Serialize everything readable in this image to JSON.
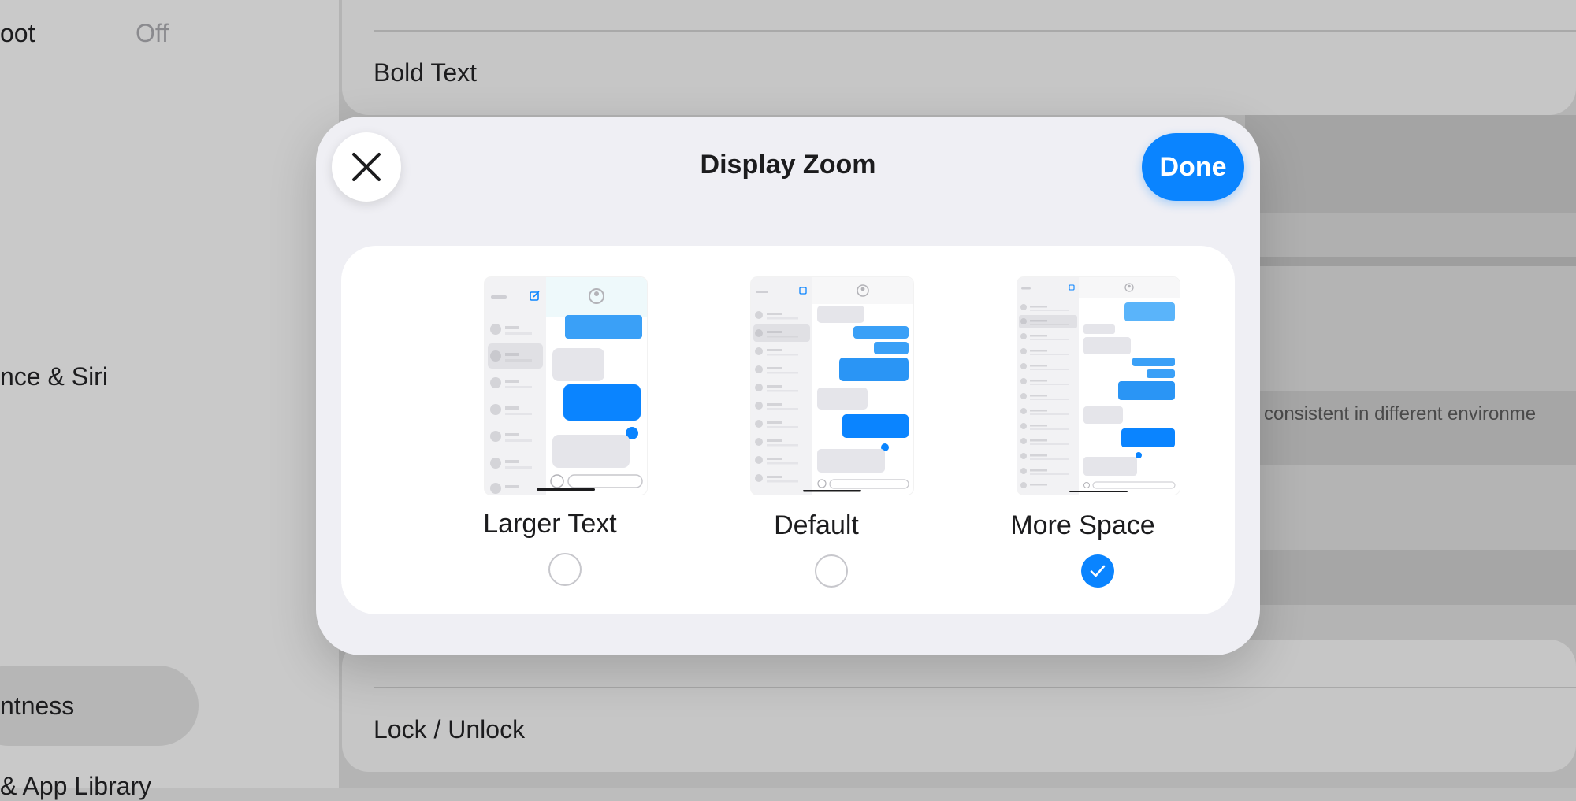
{
  "background": {
    "sidebar": {
      "items": [
        {
          "label": "oot",
          "value": "Off"
        },
        {
          "label": "nce & Siri"
        },
        {
          "label": "ntness"
        },
        {
          "label": "& App Library"
        }
      ]
    },
    "content": {
      "rows": {
        "bold_text": "Bold Text",
        "partial_text": "consistent in different environme",
        "lock_unlock": "Lock / Unlock"
      }
    }
  },
  "modal": {
    "title": "Display Zoom",
    "done_label": "Done",
    "options": [
      {
        "label": "Larger Text",
        "selected": false
      },
      {
        "label": "Default",
        "selected": false
      },
      {
        "label": "More Space",
        "selected": true
      }
    ]
  },
  "colors": {
    "accent": "#0a84ff",
    "modal_bg": "#efeff4"
  },
  "icons": [
    "close-icon",
    "checkmark-icon",
    "compose-icon",
    "avatar-icon"
  ]
}
